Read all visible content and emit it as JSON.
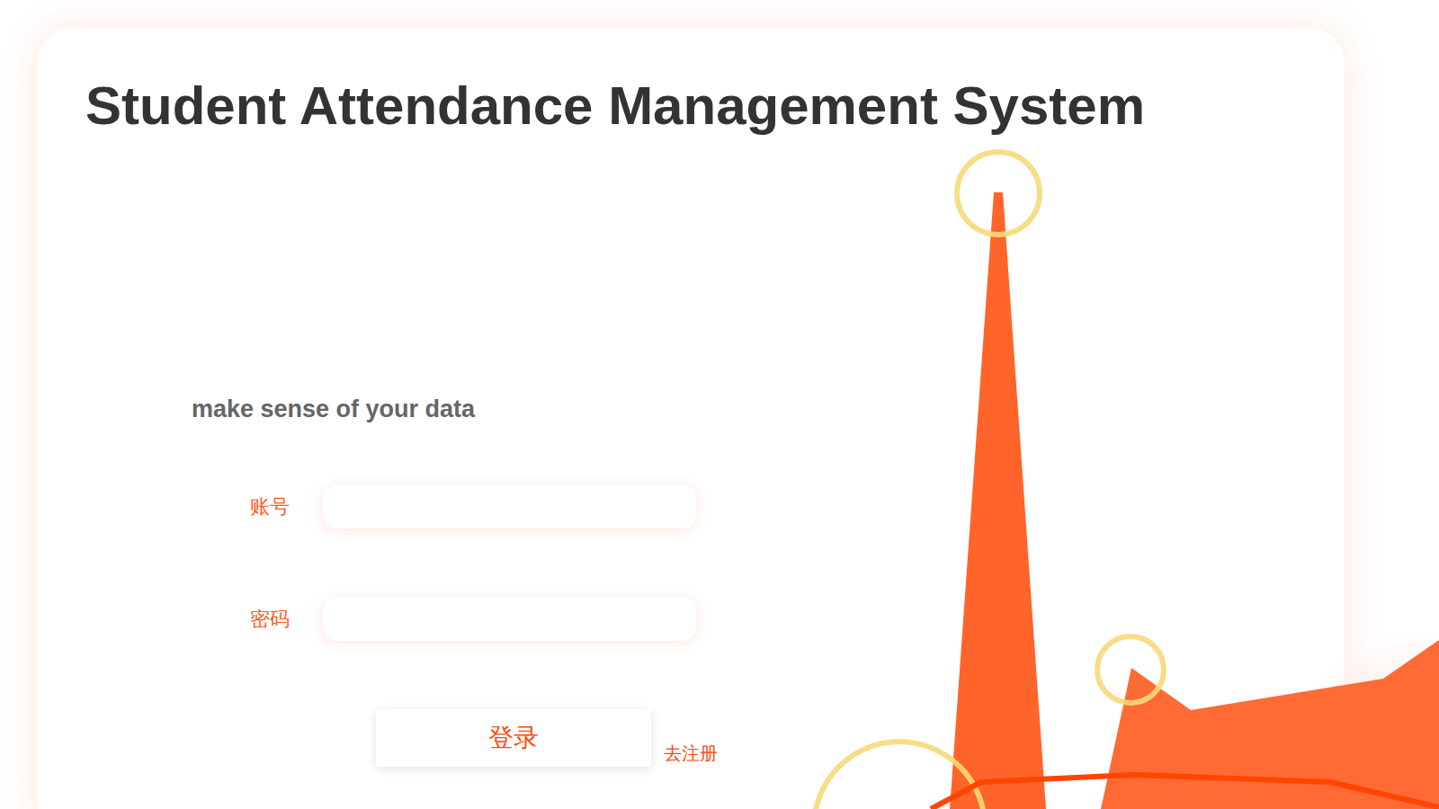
{
  "title": "Student Attendance Management System",
  "subtitle": "make sense of your data",
  "fields": [
    {
      "label": "账号",
      "value": ""
    },
    {
      "label": "密码",
      "value": ""
    }
  ],
  "login_button": "登录",
  "register_link": "去注册"
}
